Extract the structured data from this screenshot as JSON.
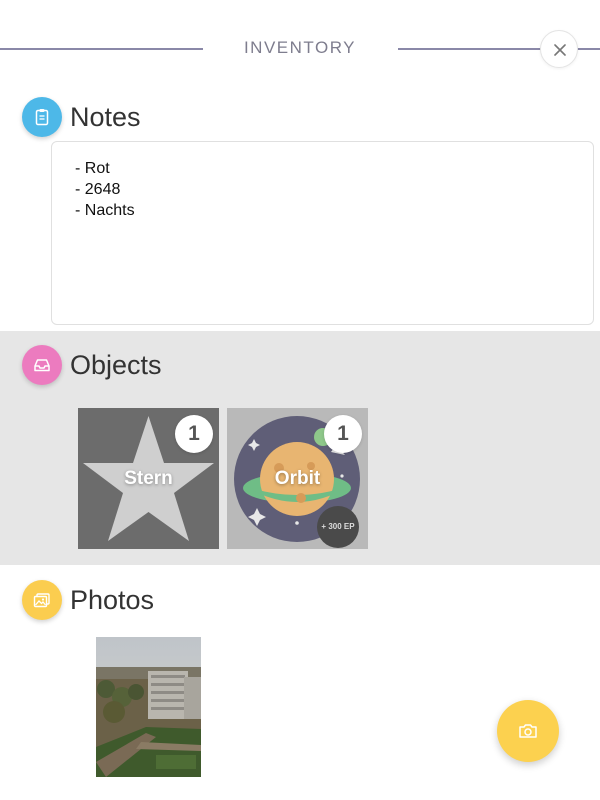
{
  "header": {
    "title": "INVENTORY",
    "close_icon": "close-icon"
  },
  "notes": {
    "title": "Notes",
    "icon": "clipboard-icon",
    "icon_color": "#4db8e8",
    "lines": [
      "- Rot",
      "- 2648",
      "- Nachts"
    ]
  },
  "objects": {
    "title": "Objects",
    "icon": "inbox-icon",
    "icon_color": "#ec7bbf",
    "band_color": "#e6e6e6",
    "items": [
      {
        "label": "Stern",
        "count": "1",
        "icon": "star-icon"
      },
      {
        "label": "Orbit",
        "count": "1",
        "icon": "planet-icon",
        "reward": "+ 300 EP"
      }
    ]
  },
  "photos": {
    "title": "Photos",
    "icon": "photos-icon",
    "icon_color": "#fbcd4f",
    "items": [
      {
        "description_icon": "photo-thumbnail"
      }
    ]
  },
  "fab": {
    "icon": "camera-icon",
    "color": "#fcd14f"
  }
}
